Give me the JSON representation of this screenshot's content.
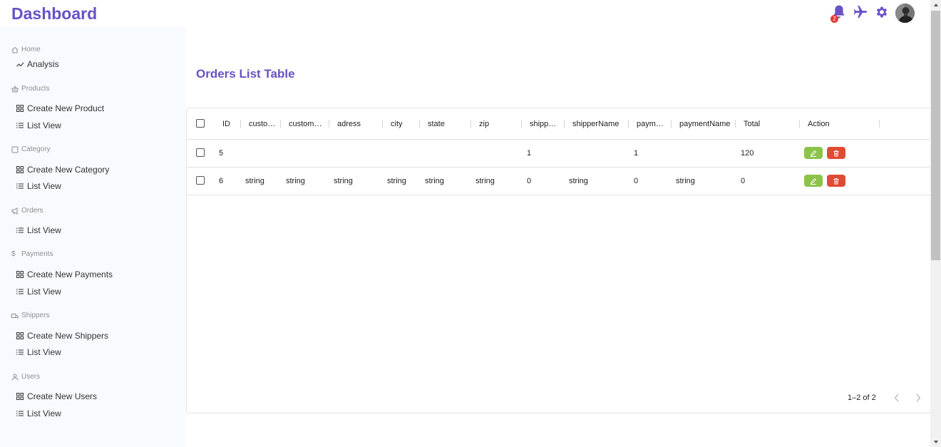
{
  "app": {
    "title": "Dashboard",
    "accent": "#6a51c6",
    "sidebar_bg": "#f7fafe"
  },
  "topbar": {
    "icons": [
      "bell-icon",
      "plane-icon",
      "gear-icon",
      "avatar"
    ],
    "notification_count": "2"
  },
  "sidebar": {
    "sections": [
      {
        "label": "Home",
        "icon": "home-icon",
        "items": [
          {
            "label": "Analysis",
            "icon": "chart-line-icon"
          }
        ]
      },
      {
        "label": "Products",
        "icon": "basket-icon",
        "items": [
          {
            "label": "Create New Product",
            "icon": "grid-icon"
          },
          {
            "label": "List View",
            "icon": "list-icon"
          }
        ]
      },
      {
        "label": "Category",
        "icon": "square-icon",
        "items": [
          {
            "label": "Create New Category",
            "icon": "grid-icon"
          },
          {
            "label": "List View",
            "icon": "list-icon"
          }
        ]
      },
      {
        "label": "Orders",
        "icon": "megaphone-icon",
        "items": [
          {
            "label": "List View",
            "icon": "list-icon"
          }
        ]
      },
      {
        "label": "Payments",
        "icon": "dollar-icon",
        "items": [
          {
            "label": "Create New Payments",
            "icon": "grid-icon"
          },
          {
            "label": "List View",
            "icon": "list-icon"
          }
        ]
      },
      {
        "label": "Shippers",
        "icon": "truck-icon",
        "items": [
          {
            "label": "Create New Shippers",
            "icon": "grid-icon"
          },
          {
            "label": "List View",
            "icon": "list-icon"
          }
        ]
      },
      {
        "label": "Users",
        "icon": "user-icon",
        "items": [
          {
            "label": "Create New Users",
            "icon": "grid-icon"
          },
          {
            "label": "List View",
            "icon": "list-icon"
          }
        ]
      }
    ]
  },
  "main": {
    "title": "Orders List Table",
    "table": {
      "columns": [
        "ID",
        "custo…",
        "custom…",
        "adress",
        "city",
        "state",
        "zip",
        "shipp…",
        "shipperName",
        "paym…",
        "paymentName",
        "Total",
        "Action"
      ],
      "rows": [
        [
          "5",
          "",
          "",
          "",
          "",
          "",
          "",
          "1",
          "",
          "1",
          "",
          "120"
        ],
        [
          "6",
          "string",
          "string",
          "string",
          "string",
          "string",
          "string",
          "0",
          "string",
          "0",
          "string",
          "0"
        ]
      ],
      "pagination": {
        "text": "1–2 of 2"
      }
    }
  }
}
